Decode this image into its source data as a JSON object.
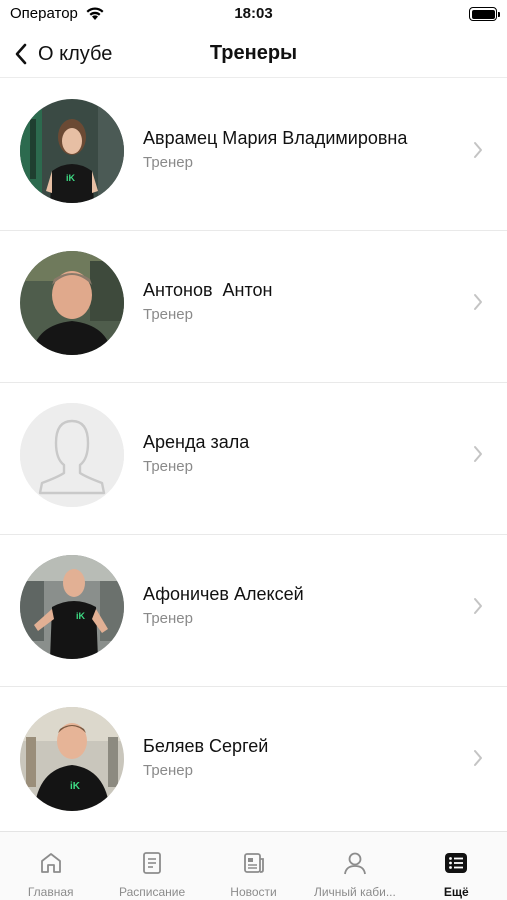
{
  "status_bar": {
    "carrier": "Оператор",
    "time": "18:03"
  },
  "nav": {
    "back_label": "О клубе",
    "title": "Тренеры"
  },
  "trainers": [
    {
      "name": "Аврамец Мария Владимировна",
      "role": "Тренер",
      "avatar": "photo"
    },
    {
      "name": "Антонов  Антон",
      "role": "Тренер",
      "avatar": "photo"
    },
    {
      "name": "Аренда зала",
      "role": "Тренер",
      "avatar": "placeholder-person-icon"
    },
    {
      "name": "Афоничев Алексей",
      "role": "Тренер",
      "avatar": "photo"
    },
    {
      "name": "Беляев Сергей",
      "role": "Тренер",
      "avatar": "photo"
    }
  ],
  "tabs": [
    {
      "label": "Главная",
      "icon": "home-icon",
      "active": false
    },
    {
      "label": "Расписание",
      "icon": "schedule-icon",
      "active": false
    },
    {
      "label": "Новости",
      "icon": "news-icon",
      "active": false
    },
    {
      "label": "Личный каби...",
      "icon": "profile-icon",
      "active": false
    },
    {
      "label": "Ещё",
      "icon": "more-list-icon",
      "active": true
    }
  ],
  "colors": {
    "accent_green": "#3ddc84",
    "text": "#111111",
    "secondary": "#8a8a8a"
  }
}
